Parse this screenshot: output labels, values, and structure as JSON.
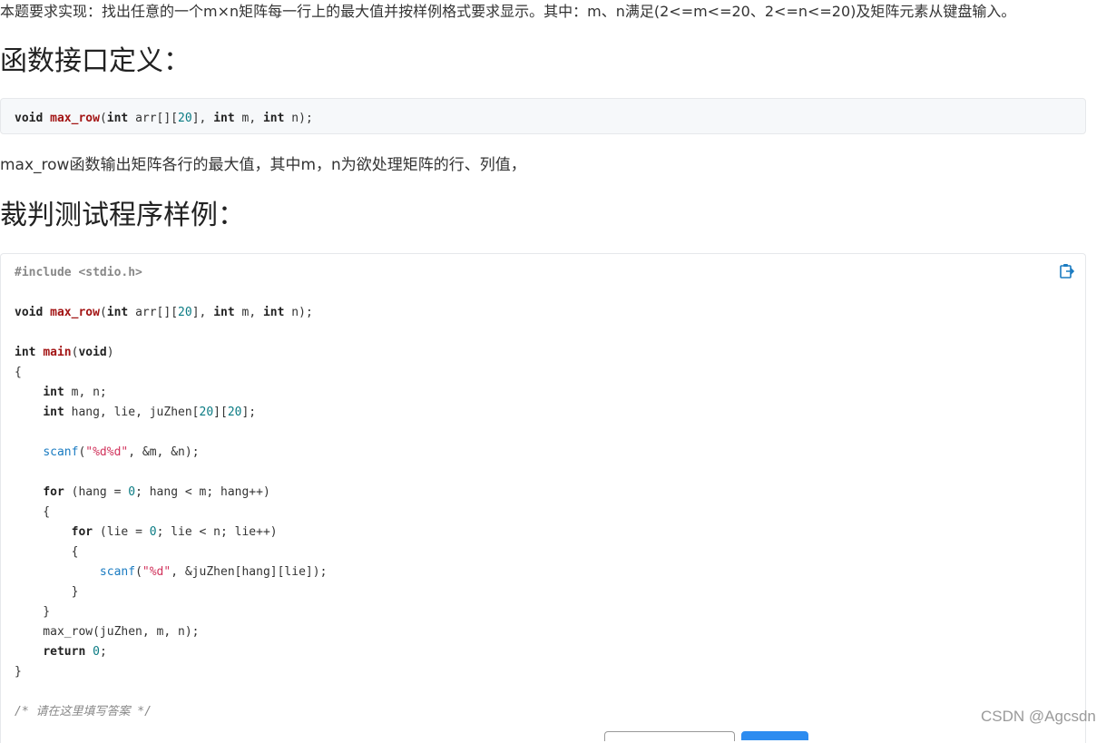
{
  "intro": "本题要求实现：找出任意的一个m×n矩阵每一行上的最大值并按样例格式要求显示。其中：m、n满足(2<=m<=20、2<=n<=20)及矩阵元素从键盘输入。",
  "h_interface": "函数接口定义：",
  "signature": {
    "void": "void",
    "name": "max_row",
    "open": "(",
    "int1": "int",
    "arr": " arr[][",
    "size": "20",
    "close1": "], ",
    "int2": "int",
    "m": " m, ",
    "int3": "int",
    "n_end": " n);"
  },
  "description": "max_row函数输出矩阵各行的最大值，其中m，n为欲处理矩阵的行、列值，",
  "h_sample": "裁判测试程序样例：",
  "code": {
    "l1": "#include <stdio.h>",
    "l3_void": "void",
    "l3_name": "max_row",
    "l3_p1": "(",
    "l3_int": "int",
    "l3_arr": " arr[][",
    "l3_n20": "20",
    "l3_p2": "], ",
    "l3_int2": "int",
    "l3_m": " m, ",
    "l3_int3": "int",
    "l3_end": " n);",
    "l5_int": "int",
    "l5_main": "main",
    "l5_p1": "(",
    "l5_void": "void",
    "l5_p2": ")",
    "l6": "{",
    "l7_indent": "    ",
    "l7_int": "int",
    "l7_rest": " m, n;",
    "l8_indent": "    ",
    "l8_int": "int",
    "l8_rest1": " hang, lie, juZhen[",
    "l8_n1": "20",
    "l8_rest2": "][",
    "l8_n2": "20",
    "l8_rest3": "];",
    "l10_indent": "    ",
    "l10_scanf": "scanf",
    "l10_p1": "(",
    "l10_str": "\"%d%d\"",
    "l10_rest": ", &m, &n);",
    "l12_indent": "    ",
    "l12_for": "for",
    "l12_rest1": " (hang = ",
    "l12_zero": "0",
    "l12_rest2": "; hang < m; hang++)",
    "l13": "    {",
    "l14_indent": "        ",
    "l14_for": "for",
    "l14_rest1": " (lie = ",
    "l14_zero": "0",
    "l14_rest2": "; lie < n; lie++)",
    "l15": "        {",
    "l16_indent": "            ",
    "l16_scanf": "scanf",
    "l16_p1": "(",
    "l16_str": "\"%d\"",
    "l16_rest": ", &juZhen[hang][lie]);",
    "l17": "        }",
    "l18": "    }",
    "l19": "    max_row(juZhen, m, n);",
    "l20_indent": "    ",
    "l20_return": "return",
    "l20_sp": " ",
    "l20_zero": "0",
    "l20_semi": ";",
    "l21": "}",
    "l23": "/* 请在这里填写答案 */"
  },
  "watermark": "CSDN @Agcsdn",
  "icons": {
    "copy": "copy-icon"
  },
  "colors": {
    "accent": "#1a7bc1",
    "button": "#2d8cf0"
  }
}
